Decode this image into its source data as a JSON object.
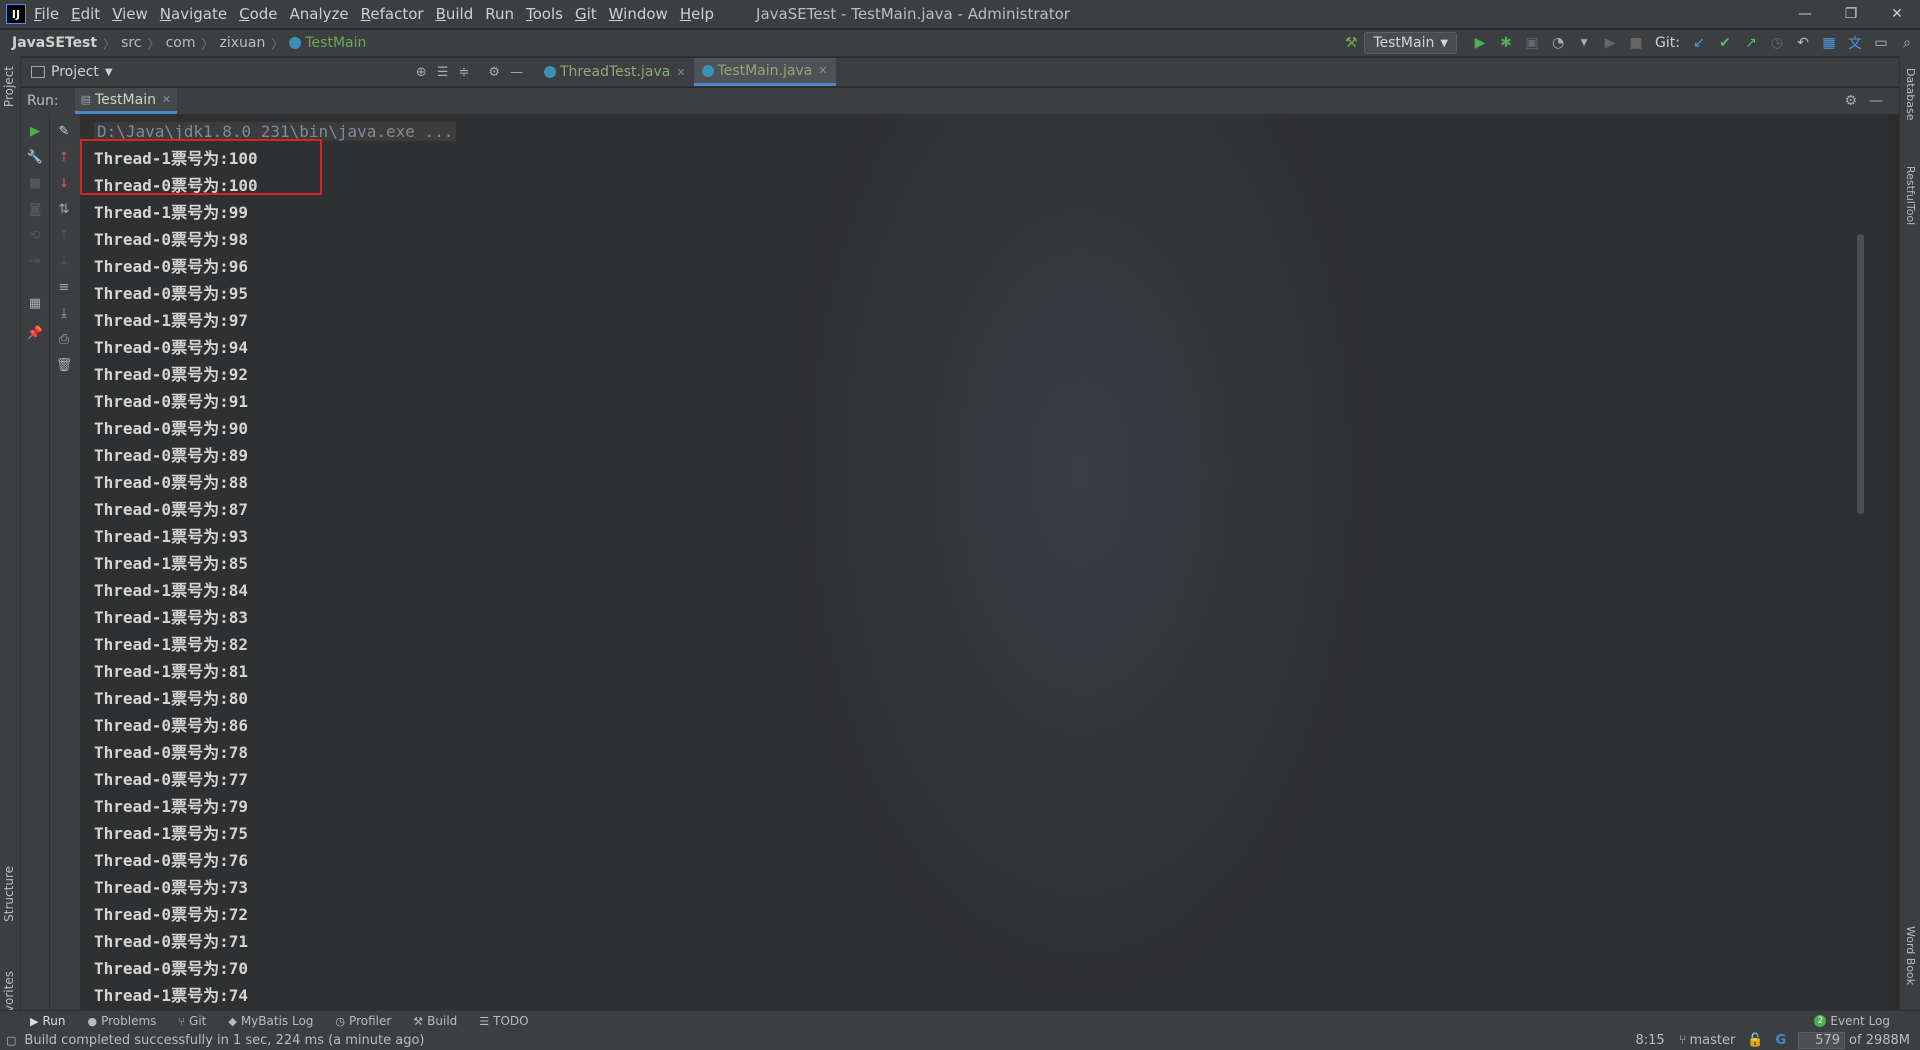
{
  "menubar": {
    "logo": "IJ",
    "items": [
      {
        "mn": "F",
        "rest": "ile"
      },
      {
        "mn": "E",
        "rest": "dit"
      },
      {
        "mn": "V",
        "rest": "iew"
      },
      {
        "mn": "N",
        "rest": "avigate"
      },
      {
        "mn": "C",
        "rest": "ode"
      },
      {
        "mn": "",
        "rest": "Analyze"
      },
      {
        "mn": "R",
        "rest": "efactor"
      },
      {
        "mn": "B",
        "rest": "uild"
      },
      {
        "mn": "",
        "rest": "Run"
      },
      {
        "mn": "T",
        "rest": "ools"
      },
      {
        "mn": "G",
        "rest": "it"
      },
      {
        "mn": "W",
        "rest": "indow"
      },
      {
        "mn": "H",
        "rest": "elp"
      }
    ],
    "window_title": "JavaSETest - TestMain.java - Administrator"
  },
  "navbar": {
    "crumbs": [
      "JavaSETest",
      "src",
      "com",
      "zixuan"
    ],
    "class_crumb": "TestMain",
    "run_config": "TestMain",
    "git_label": "Git:"
  },
  "tabs": {
    "project_label": "Project",
    "files": [
      {
        "name": "ThreadTest.java",
        "active": false
      },
      {
        "name": "TestMain.java",
        "active": true
      }
    ]
  },
  "run": {
    "label": "Run:",
    "tab": "TestMain",
    "command": "D:\\Java\\jdk1.8.0_231\\bin\\java.exe ...",
    "lines": [
      "Thread-1票号为:100",
      "Thread-0票号为:100",
      "Thread-1票号为:99",
      "Thread-0票号为:98",
      "Thread-0票号为:96",
      "Thread-0票号为:95",
      "Thread-1票号为:97",
      "Thread-0票号为:94",
      "Thread-0票号为:92",
      "Thread-0票号为:91",
      "Thread-0票号为:90",
      "Thread-0票号为:89",
      "Thread-0票号为:88",
      "Thread-0票号为:87",
      "Thread-1票号为:93",
      "Thread-1票号为:85",
      "Thread-1票号为:84",
      "Thread-1票号为:83",
      "Thread-1票号为:82",
      "Thread-1票号为:81",
      "Thread-1票号为:80",
      "Thread-0票号为:86",
      "Thread-0票号为:78",
      "Thread-0票号为:77",
      "Thread-1票号为:79",
      "Thread-1票号为:75",
      "Thread-0票号为:76",
      "Thread-0票号为:73",
      "Thread-0票号为:72",
      "Thread-0票号为:71",
      "Thread-0票号为:70",
      "Thread-1票号为:74"
    ]
  },
  "side_tabs": {
    "left": [
      "Project",
      "Structure",
      "Favorites"
    ],
    "right": [
      "Database",
      "RestfulTool",
      "Word Book"
    ]
  },
  "bottom_tabs": [
    {
      "icon": "▶",
      "label": "Run",
      "active": true
    },
    {
      "icon": "●",
      "label": "Problems"
    },
    {
      "icon": "⑂",
      "label": "Git"
    },
    {
      "icon": "◆",
      "label": "MyBatis Log"
    },
    {
      "icon": "◷",
      "label": "Profiler"
    },
    {
      "icon": "⚒",
      "label": "Build"
    },
    {
      "icon": "☰",
      "label": "TODO"
    }
  ],
  "event_log": {
    "count": "2",
    "label": "Event Log"
  },
  "status": {
    "message": "Build completed successfully in 1 sec, 224 ms (a minute ago)",
    "position": "8:15",
    "branch": "master",
    "memory": "579",
    "memory_total": "of 2988M"
  },
  "colors": {
    "highlight_border": "#e02020",
    "accent": "#4a88c7",
    "run_green": "#4caf50"
  }
}
